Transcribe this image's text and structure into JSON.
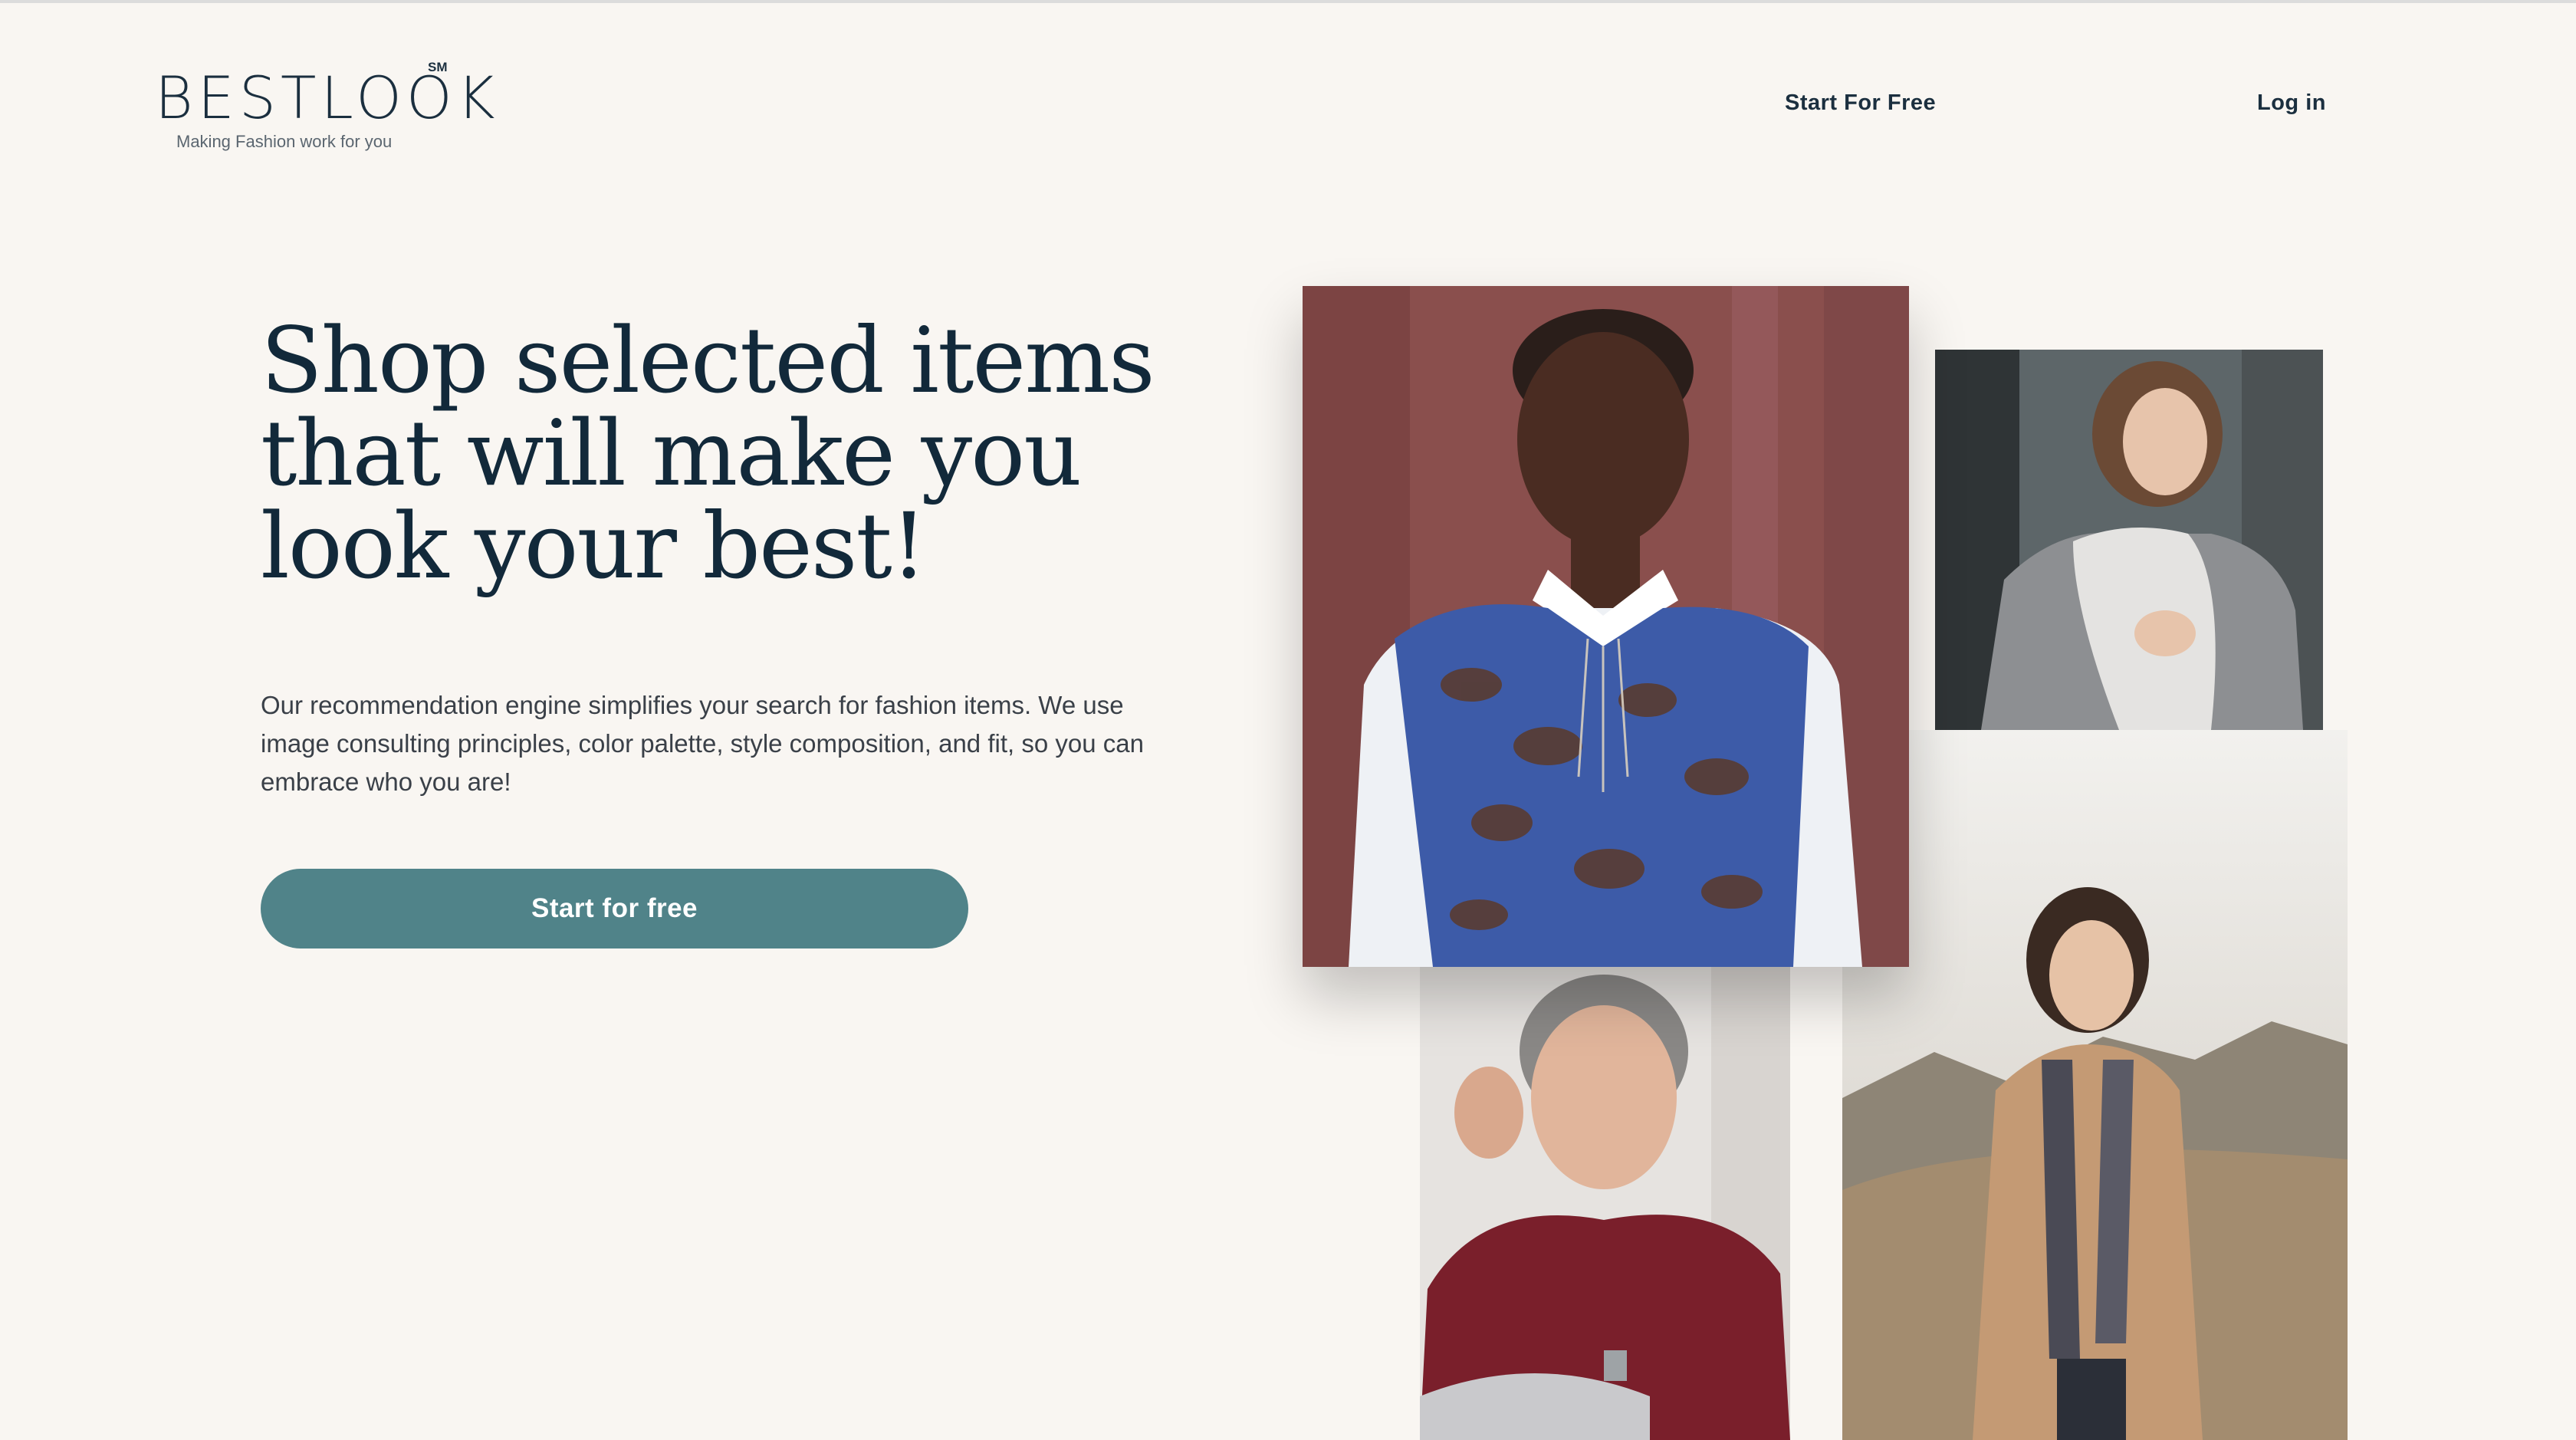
{
  "header": {
    "logo_text": "BESTLOOK",
    "logo_mark": "SM",
    "tagline": "Making Fashion work for you",
    "nav": {
      "start_label": "Start For Free",
      "login_label": "Log in"
    }
  },
  "hero": {
    "title": "Shop selected items that will make you look your best!",
    "description": "Our recommendation engine simplifies your search for fashion items. We use image consulting principles, color palette, style composition, and fit, so you can embrace who you are!",
    "cta_label": "Start for free"
  },
  "photos": [
    {
      "name": "photo-woman-patterned-top",
      "bg": "#8a4f4d"
    },
    {
      "name": "photo-woman-grey-scarf",
      "bg": "#5d6669"
    },
    {
      "name": "photo-woman-red-blouse",
      "bg": "#e6e3e0"
    },
    {
      "name": "photo-woman-camel-coat",
      "bg": "#b8ada0"
    }
  ],
  "colors": {
    "background": "#f9f6f2",
    "primary_text": "#12293a",
    "cta": "#508389"
  }
}
